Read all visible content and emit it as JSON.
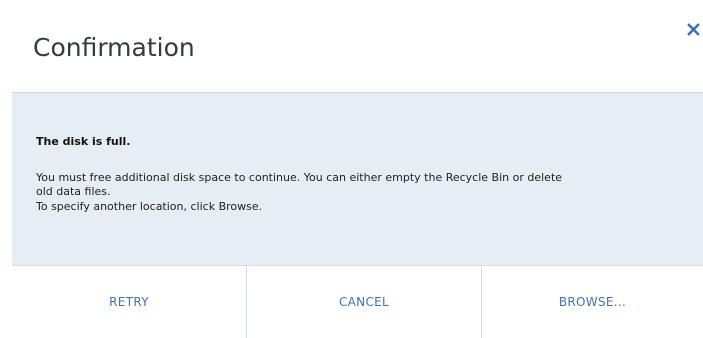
{
  "dialog": {
    "title": "Confirmation",
    "close_icon": "close-icon",
    "message": {
      "headline": "The disk is full.",
      "lines": [
        "You must free additional disk space to continue. You can either empty the Recycle Bin or delete",
        "old data files.",
        "To specify another location, click Browse."
      ]
    },
    "buttons": {
      "retry": "RETRY",
      "cancel": "CANCEL",
      "browse": "BROWSE..."
    }
  },
  "colors": {
    "accent": "#3f73b7",
    "content_background": "#e6edf5"
  }
}
